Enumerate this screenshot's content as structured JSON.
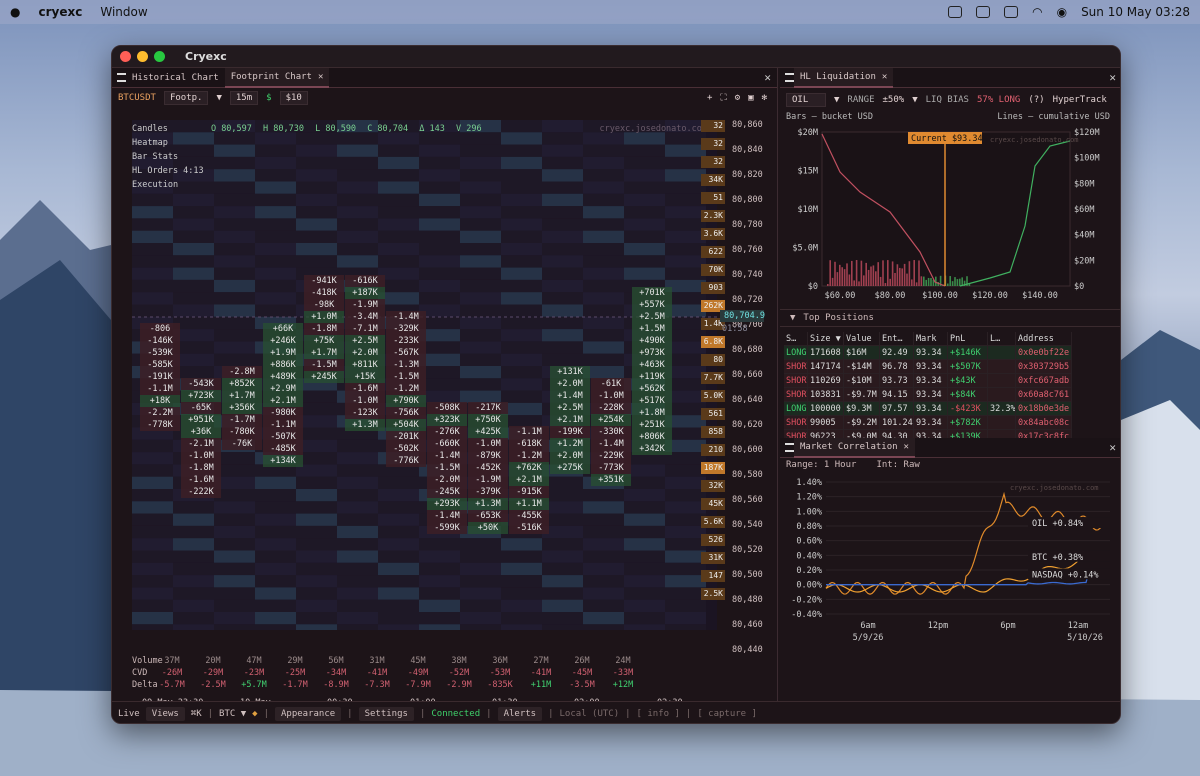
{
  "menubar": {
    "app": "cryexc",
    "menu": "Window",
    "datetime": "Sun 10 May  03:28"
  },
  "window": {
    "title": "Cryexc"
  },
  "left_panel": {
    "tabs": [
      {
        "label": "Historical Chart"
      },
      {
        "label": "Footprint Chart"
      }
    ],
    "toolbar": {
      "symbol": "BTCUSDT",
      "chart_type": "Footp.",
      "interval": "15m",
      "size_label": "$",
      "size_value": "$10"
    },
    "overlay": {
      "items": [
        "Candles",
        "Heatmap",
        "Bar Stats",
        "HL Orders 4:13",
        "Execution"
      ],
      "ohlc": {
        "o": "O 80,597",
        "h": "H 80,730",
        "l": "L 80,590",
        "c": "C 80,704",
        "d": "Δ 143",
        "v": "V 296"
      },
      "watermark": "cryexc.josedonato.com"
    },
    "price_labels": [
      "80,860",
      "80,840",
      "80,820",
      "80,800",
      "80,780",
      "80,760",
      "80,740",
      "80,720",
      "80,700",
      "80,680",
      "80,660",
      "80,640",
      "80,620",
      "80,600",
      "80,580",
      "80,560",
      "80,540",
      "80,520",
      "80,500",
      "80,480",
      "80,460",
      "80,440"
    ],
    "current_price": "80,704.9",
    "countdown": "01:58",
    "volume_profile": [
      "32",
      "32",
      "32",
      "34K",
      "51",
      "2.3K",
      "3.6K",
      "622",
      "70K",
      "903",
      "262K",
      "1.4K",
      "6.8K",
      "80",
      "7.7K",
      "5.0K",
      "561",
      "858",
      "210",
      "187K",
      "32K",
      "45K",
      "5.6K",
      "526",
      "31K",
      "147",
      "2.5K"
    ],
    "columns": [
      {
        "cells": [
          "-806",
          "-146K",
          "-539K",
          "-585K",
          "-191K",
          "-1.1M",
          "+18K",
          "-2.2M",
          "-778K"
        ]
      },
      {
        "cells": [
          "-543K",
          "+723K",
          "-65K",
          "+951K",
          "+36K",
          "-2.1M",
          "-1.0M",
          "-1.8M",
          "-1.6M",
          "-222K"
        ]
      },
      {
        "cells": [
          "-2.8M",
          "+852K",
          "+1.7M",
          "+356K",
          "-1.7M",
          "-780K",
          "-76K"
        ]
      },
      {
        "cells": [
          "+66K",
          "+246K",
          "+1.9M",
          "+886K",
          "+489K",
          "+2.9M",
          "+2.1M",
          "-980K",
          "-1.1M",
          "-507K",
          "-485K",
          "+134K"
        ]
      },
      {
        "cells": [
          "-941K",
          "-418K",
          "-98K",
          "+1.0M",
          "-1.8M",
          "+75K",
          "+1.7M",
          "-1.5M",
          "+245K"
        ]
      },
      {
        "cells": [
          "-616K",
          "+187K",
          "-1.9M",
          "-3.4M",
          "-7.1M",
          "+2.5M",
          "+2.0M",
          "+811K",
          "+15K",
          "-1.6M",
          "-1.0M",
          "-123K",
          "+1.3M"
        ]
      },
      {
        "cells": [
          "-1.4M",
          "-329K",
          "-233K",
          "-567K",
          "-1.3M",
          "-1.5M",
          "-1.2M",
          "+790K",
          "-756K",
          "+504K",
          "-201K",
          "-502K",
          "-776K"
        ]
      },
      {
        "cells": [
          "-508K",
          "+323K",
          "-276K",
          "-660K",
          "-1.4M",
          "-1.5M",
          "-2.0M",
          "-245K",
          "+293K",
          "-1.4M",
          "-599K"
        ]
      },
      {
        "cells": [
          "-217K",
          "+750K",
          "+425K",
          "-1.0M",
          "-879K",
          "-452K",
          "-1.9M",
          "-379K",
          "+1.3M",
          "-653K",
          "+50K"
        ]
      },
      {
        "cells": [
          "-1.1M",
          "-618K",
          "-1.2M",
          "+762K",
          "+2.1M",
          "-915K",
          "+1.1M",
          "-455K",
          "-516K"
        ]
      },
      {
        "cells": [
          "+131K",
          "+2.0M",
          "+1.4M",
          "+2.5M",
          "+2.1M",
          "-199K",
          "+1.2M",
          "+2.0M",
          "+275K"
        ]
      },
      {
        "cells": [
          "-61K",
          "-1.0M",
          "-228K",
          "+254K",
          "-330K",
          "-1.4M",
          "-229K",
          "-773K",
          "+351K"
        ]
      },
      {
        "cells": [
          "+701K",
          "+557K",
          "+2.5M",
          "+1.5M",
          "+490K",
          "+973K",
          "+463K",
          "+119K",
          "+562K",
          "+517K",
          "+1.8M",
          "+251K",
          "+806K",
          "+342K"
        ]
      }
    ],
    "metrics": {
      "labels": [
        "Volume",
        "CVD",
        "Delta"
      ],
      "volume": [
        "37M",
        "20M",
        "47M",
        "29M",
        "56M",
        "31M",
        "45M",
        "38M",
        "36M",
        "27M",
        "26M",
        "24M"
      ],
      "cvd": [
        "-26M",
        "-29M",
        "-23M",
        "-25M",
        "-34M",
        "-41M",
        "-49M",
        "-52M",
        "-53M",
        "-41M",
        "-45M",
        "-33M"
      ],
      "delta": [
        "-5.7M",
        "-2.5M",
        "+5.7M",
        "-1.7M",
        "-8.9M",
        "-7.3M",
        "-7.9M",
        "-2.9M",
        "-835K",
        "+11M",
        "-3.5M",
        "+12M"
      ]
    },
    "time_labels": [
      "09 May 23:30",
      "10 May",
      "00:30",
      "01:00",
      "01:30",
      "02:00",
      "02:30"
    ]
  },
  "right_panel": {
    "liq_tab": "HL Liquidation",
    "controls": {
      "asset": "OIL",
      "range_label": "RANGE",
      "range_value": "±50%",
      "bias_label": "LIQ BIAS",
      "bias_value": "57% LONG",
      "help": "(?)",
      "source": "HyperTrack"
    },
    "legend": {
      "bars": "Bars — bucket USD",
      "lines": "Lines — cumulative USD"
    },
    "current_label": "Current $93.34",
    "watermark": "cryexc.josedonato.com",
    "y_left": [
      "$20M",
      "$15M",
      "$10M",
      "$5.0M",
      "$0"
    ],
    "y_right": [
      "$120M",
      "$100M",
      "$80M",
      "$60M",
      "$40M",
      "$20M",
      "$0"
    ],
    "x_labels": [
      "$60.00",
      "$80.00",
      "$100.00",
      "$120.00",
      "$140.00"
    ],
    "positions_title": "Top Positions",
    "table_headers": [
      "S…",
      "Size ▼",
      "Value",
      "Ent…",
      "Mark",
      "PnL",
      "L…",
      "Address"
    ],
    "table_rows": [
      [
        "LONG",
        "171608",
        "$16M",
        "92.49",
        "93.34",
        "+$146K",
        "",
        "0x0e0bf22e"
      ],
      [
        "SHORT",
        "147174",
        "-$14M",
        "96.78",
        "93.34",
        "+$507K",
        "",
        "0x303729b5"
      ],
      [
        "SHORT",
        "110269",
        "-$10M",
        "93.73",
        "93.34",
        "+$43K",
        "",
        "0xfc667adb"
      ],
      [
        "SHORT",
        "103831",
        "-$9.7M",
        "94.15",
        "93.34",
        "+$84K",
        "",
        "0x60a8c761"
      ],
      [
        "LONG",
        "100000",
        "$9.3M",
        "97.57",
        "93.34",
        "-$423K",
        "32.3%",
        "0x18b0e3de"
      ],
      [
        "SHORT",
        "99005",
        "-$9.2M",
        "101.24",
        "93.34",
        "+$782K",
        "",
        "0x84abc08c"
      ],
      [
        "SHORT",
        "96223",
        "-$9.0M",
        "94.30",
        "93.34",
        "+$139K",
        "",
        "0x17c3c8fc"
      ]
    ],
    "corr_tab": "Market Correlation",
    "corr_controls": {
      "range": "Range: 1 Hour",
      "interval": "Int: Raw"
    },
    "corr_y": [
      "1.40%",
      "1.20%",
      "1.00%",
      "0.80%",
      "0.60%",
      "0.40%",
      "0.20%",
      "0.00%",
      "-0.20%",
      "-0.40%"
    ],
    "corr_x": [
      "6am",
      "12pm",
      "6pm",
      "12am"
    ],
    "corr_dates": [
      "5/9/26",
      "5/10/26"
    ],
    "corr_series": [
      {
        "name": "OIL",
        "value": "+0.84%",
        "color": "#e08a2a"
      },
      {
        "name": "BTC",
        "value": "+0.38%",
        "color": "#f0a030"
      },
      {
        "name": "NASDAQ",
        "value": "+0.14%",
        "color": "#3a6ad0"
      }
    ]
  },
  "statusbar": {
    "items": [
      "Live",
      "Views",
      "⌘K",
      "BTC ▼",
      "Appearance",
      "Settings",
      "Connected",
      "Alerts",
      "Local (UTC)",
      "[ info ]",
      "[ capture ]"
    ]
  }
}
